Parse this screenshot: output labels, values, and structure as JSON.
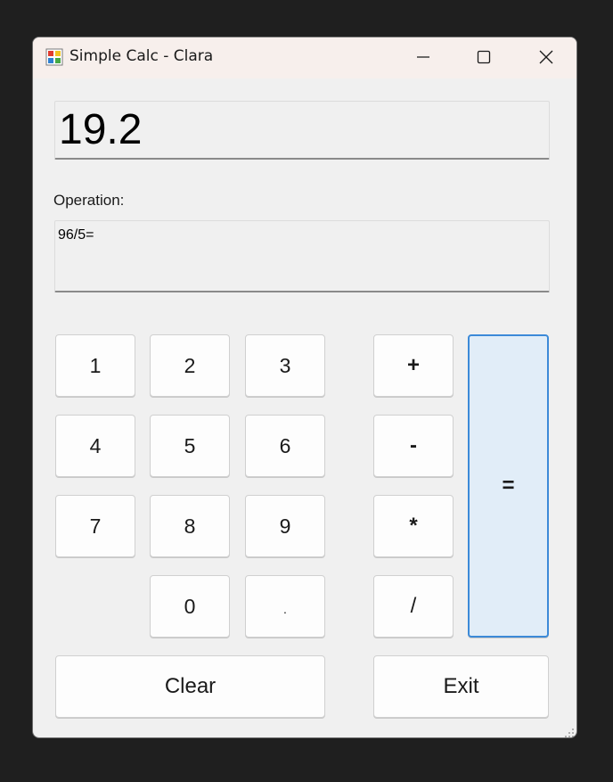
{
  "window": {
    "title": "Simple Calc - Clara",
    "controls": {
      "minimize_icon": "minimize-icon",
      "maximize_icon": "maximize-icon",
      "close_icon": "close-icon"
    }
  },
  "display": {
    "value": "19.2"
  },
  "operation": {
    "label": "Operation:",
    "value": "96/5="
  },
  "keypad": {
    "digits": [
      "1",
      "2",
      "3",
      "4",
      "5",
      "6",
      "7",
      "8",
      "9",
      "0",
      "."
    ],
    "operators": [
      "+",
      "-",
      "*",
      "/"
    ],
    "equals": "="
  },
  "actions": {
    "clear_label": "Clear",
    "exit_label": "Exit"
  },
  "colors": {
    "accent": "#3c8ad8",
    "equals_bg": "#e1edf8",
    "window_bg": "#f0f0f0",
    "titlebar_bg": "#f7efec"
  }
}
